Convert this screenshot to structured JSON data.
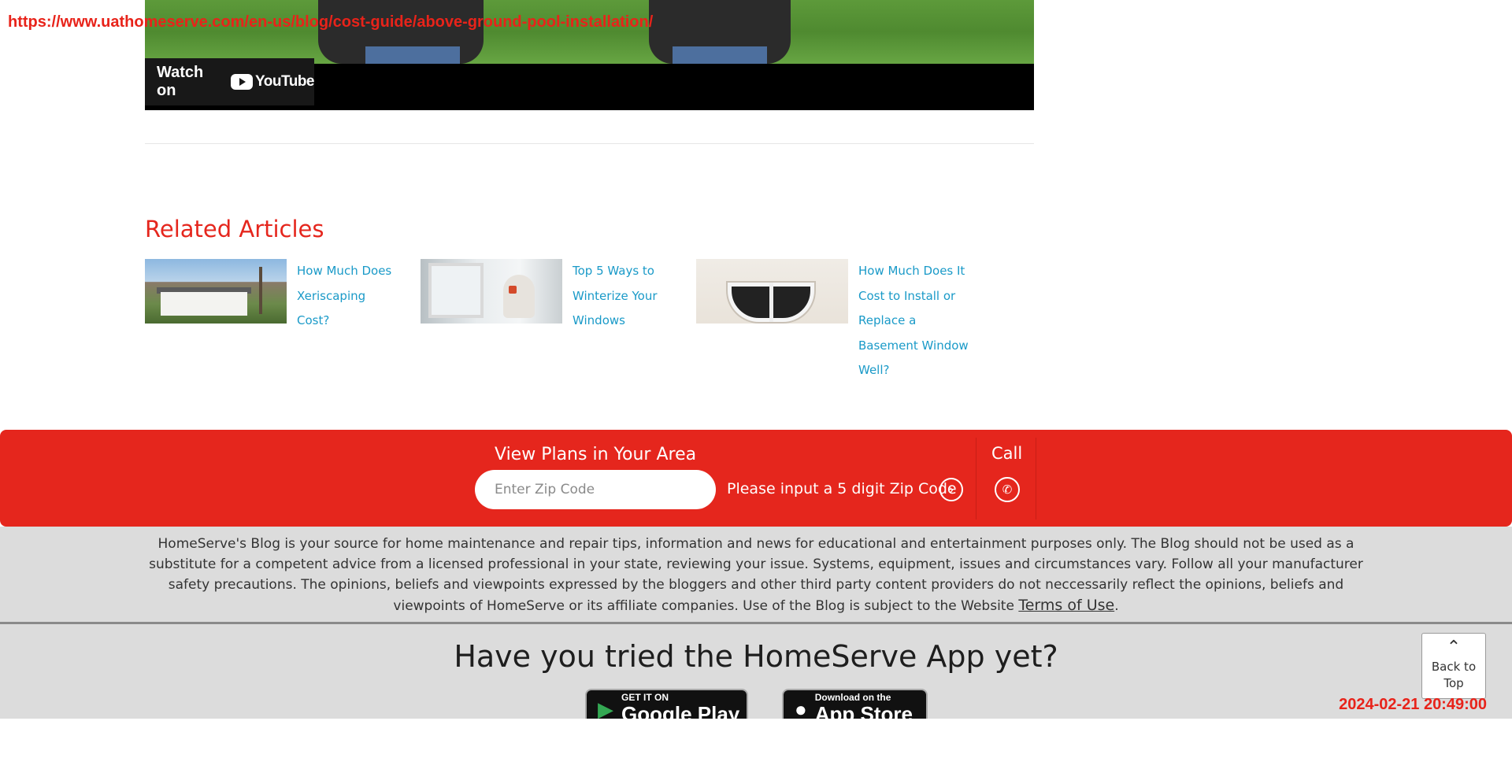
{
  "overlay": {
    "url": "https://www.uathomeserve.com/en-us/blog/cost-guide/above-ground-pool-installation/",
    "timestamp": "2024-02-21 20:49:00"
  },
  "video": {
    "watch_on": "Watch on",
    "provider": "YouTube"
  },
  "related": {
    "title": "Related Articles",
    "articles": [
      {
        "title": "How Much Does Xeriscaping Cost?",
        "thumb": "desert-house-thumbnail"
      },
      {
        "title": "Top 5 Ways to Winterize Your Windows",
        "thumb": "woman-by-window-thumbnail"
      },
      {
        "title": "How Much Does It Cost to Install or Replace a Basement Window Well?",
        "thumb": "basement-window-well-thumbnail"
      }
    ]
  },
  "plans": {
    "heading": "View Plans in Your Area",
    "zip_placeholder": "Enter Zip Code",
    "zip_error": "Please input a 5 digit Zip Code",
    "go_icon": "chevron-right-icon",
    "call_label": "Call",
    "call_icon": "phone-icon"
  },
  "disclaimer": {
    "text": "HomeServe's Blog is your source for home maintenance and repair tips, information and news for educational and entertainment purposes only. The Blog should not be used as a substitute for a competent advice from a licensed professional in your state, reviewing your issue. Systems, equipment, issues and circumstances vary. Follow all your manufacturer safety precautions. The opinions, beliefs and viewpoints expressed by the bloggers and other third party content providers do not neccessarily reflect the opinions, beliefs and viewpoints of HomeServe or its affiliate companies. Use of the Blog is subject to the Website ",
    "terms_link": "Terms of Use",
    "end": "."
  },
  "app": {
    "title": "Have you tried the HomeServe App yet?",
    "google_small": "GET IT ON",
    "google_big": "Google Play",
    "apple_small": "Download on the",
    "apple_big": "App Store"
  },
  "back_to_top": {
    "label": "Back to Top"
  },
  "colors": {
    "brand_red": "#e5261d",
    "link_blue": "#1a9ac8",
    "footer_grey": "#dcdcdc"
  }
}
